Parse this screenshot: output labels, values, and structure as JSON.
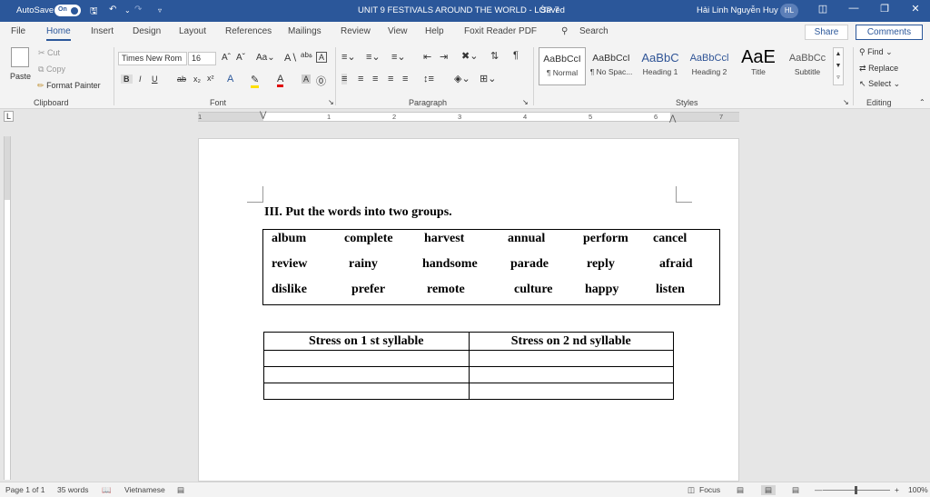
{
  "titlebar": {
    "autosave_label": "AutoSave",
    "autosave_state": "On",
    "document_title": "UNIT 9 FESTIVALS AROUND THE WORLD - LỚP 7",
    "save_status": "Saved",
    "user_name": "Hải Linh Nguyễn Huy",
    "user_initials": "HL"
  },
  "tabs": [
    "File",
    "Home",
    "Insert",
    "Design",
    "Layout",
    "References",
    "Mailings",
    "Review",
    "View",
    "Help",
    "Foxit Reader PDF"
  ],
  "active_tab": "Home",
  "search_label": "Search",
  "share_label": "Share",
  "comments_label": "Comments",
  "clipboard": {
    "paste": "Paste",
    "cut": "Cut",
    "copy": "Copy",
    "format_painter": "Format Painter",
    "group": "Clipboard"
  },
  "font": {
    "name": "Times New Rom",
    "size": "16",
    "group": "Font"
  },
  "paragraph": {
    "group": "Paragraph"
  },
  "styles": {
    "group": "Styles",
    "items": [
      {
        "preview": "AaBbCcI",
        "name": "¶ Normal"
      },
      {
        "preview": "AaBbCcI",
        "name": "¶ No Spac..."
      },
      {
        "preview": "AaBbC",
        "name": "Heading 1"
      },
      {
        "preview": "AaBbCcl",
        "name": "Heading 2"
      },
      {
        "preview": "AaE",
        "name": "Title"
      },
      {
        "preview": "AaBbCc",
        "name": "Subtitle"
      }
    ]
  },
  "editing": {
    "find": "Find",
    "replace": "Replace",
    "select": "Select",
    "group": "Editing"
  },
  "ruler_numbers": [
    "1",
    "1",
    "2",
    "3",
    "4",
    "5",
    "6",
    "7"
  ],
  "document": {
    "question": "III. Put the words into two groups.",
    "words": [
      [
        "album",
        "complete",
        "harvest",
        "annual",
        "perform",
        "cancel"
      ],
      [
        "review",
        "rainy",
        "handsome",
        "parade",
        "reply",
        "afraid"
      ],
      [
        "dislike",
        "prefer",
        "remote",
        "culture",
        "happy",
        "listen"
      ]
    ],
    "table_headers": [
      "Stress on 1 st syllable",
      "Stress on 2 nd syllable"
    ]
  },
  "statusbar": {
    "page": "Page 1 of 1",
    "words": "35 words",
    "language": "Vietnamese",
    "focus": "Focus",
    "zoom": "100%"
  },
  "colors": {
    "accent": "#2b579a"
  }
}
